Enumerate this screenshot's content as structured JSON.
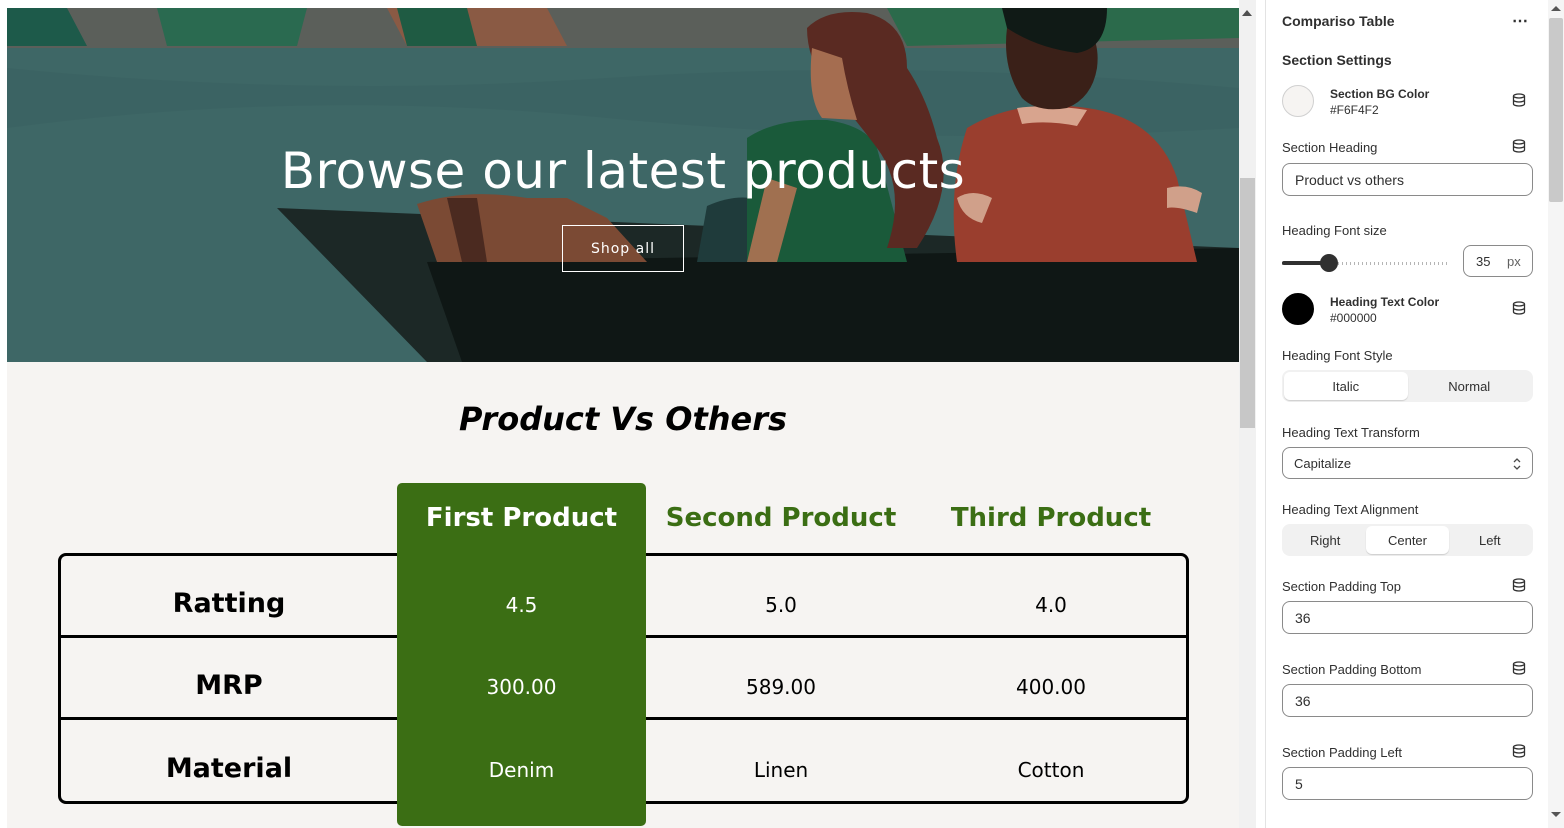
{
  "hero": {
    "title": "Browse our latest products",
    "button_label": "Shop all"
  },
  "comparison": {
    "heading": "Product Vs Others",
    "columns": [
      "First Product",
      "Second Product",
      "Third Product"
    ],
    "rows": [
      {
        "label": "Ratting",
        "values": [
          "4.5",
          "5.0",
          "4.0"
        ]
      },
      {
        "label": "MRP",
        "values": [
          "300.00",
          "589.00",
          "400.00"
        ]
      },
      {
        "label": "Material",
        "values": [
          "Denim",
          "Linen",
          "Cotton"
        ]
      }
    ],
    "highlight_color": "#3b6e14"
  },
  "panel": {
    "title": "Compariso Table",
    "more_icon": "more-horizontal-icon",
    "section_title": "Section Settings",
    "bg_color": {
      "label": "Section BG Color",
      "value": "#F6F4F2"
    },
    "section_heading": {
      "label": "Section Heading",
      "value": "Product vs others"
    },
    "font_size": {
      "label": "Heading Font size",
      "value": "35",
      "unit": "px"
    },
    "text_color": {
      "label": "Heading Text Color",
      "value": "#000000"
    },
    "font_style": {
      "label": "Heading Font Style",
      "options": [
        "Italic",
        "Normal"
      ],
      "selected": "Italic"
    },
    "text_transform": {
      "label": "Heading Text Transform",
      "value": "Capitalize"
    },
    "alignment": {
      "label": "Heading Text Alignment",
      "options": [
        "Right",
        "Center",
        "Left"
      ],
      "selected": "Center"
    },
    "padding_top": {
      "label": "Section Padding Top",
      "value": "36"
    },
    "padding_bottom": {
      "label": "Section Padding Bottom",
      "value": "36"
    },
    "padding_left": {
      "label": "Section Padding Left",
      "value": "5"
    }
  }
}
